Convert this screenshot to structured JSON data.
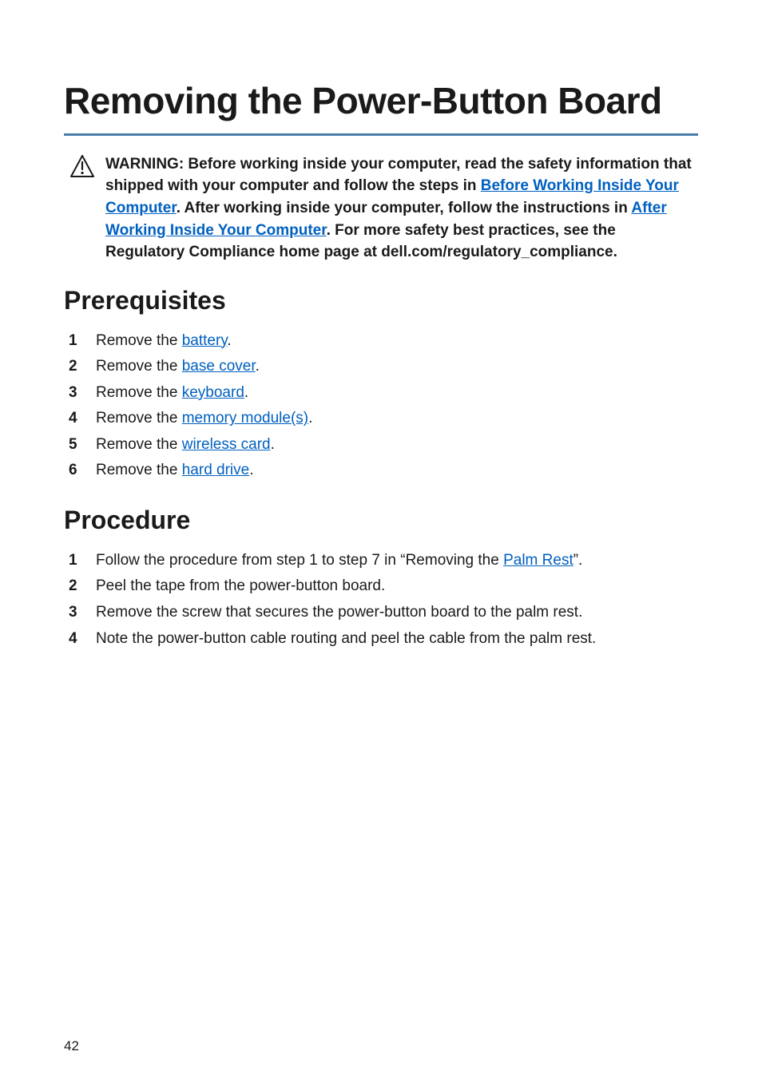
{
  "title": "Removing the Power-Button Board",
  "warning": {
    "prefix": "WARNING: Before working inside your computer, read the safety information that shipped with your computer and follow the steps in ",
    "link1": "Before Working Inside Your Computer",
    "mid1": ". After working inside your computer, follow the instructions in ",
    "link2": "After Working Inside Your Computer",
    "suffix": ". For more safety best practices, see the Regulatory Compliance home page at dell.com/regulatory_compliance."
  },
  "sections": {
    "prereq": {
      "heading": "Prerequisites",
      "items": [
        {
          "pre": "Remove the ",
          "link": "battery",
          "post": "."
        },
        {
          "pre": "Remove the ",
          "link": "base cover",
          "post": "."
        },
        {
          "pre": "Remove the ",
          "link": "keyboard",
          "post": "."
        },
        {
          "pre": "Remove the ",
          "link": "memory module(s)",
          "post": "."
        },
        {
          "pre": "Remove the ",
          "link": "wireless card",
          "post": "."
        },
        {
          "pre": "Remove the ",
          "link": "hard drive",
          "post": "."
        }
      ]
    },
    "procedure": {
      "heading": "Procedure",
      "items": [
        {
          "pre": "Follow the procedure from step 1 to step 7 in “Removing the ",
          "link": "Palm Rest",
          "post": "”."
        },
        {
          "pre": "Peel the tape from the power-button board.",
          "link": "",
          "post": ""
        },
        {
          "pre": "Remove the screw that secures the power-button board to the palm rest.",
          "link": "",
          "post": ""
        },
        {
          "pre": "Note the power-button cable routing and peel the cable from the palm rest.",
          "link": "",
          "post": ""
        }
      ]
    }
  },
  "pageNumber": "42"
}
